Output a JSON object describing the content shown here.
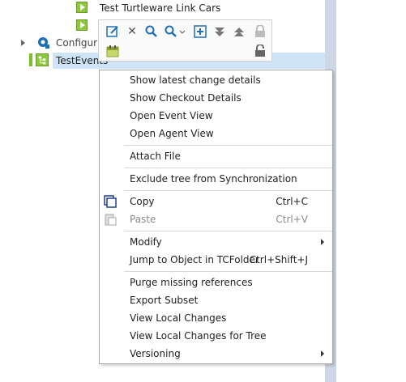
{
  "tree": {
    "items": [
      {
        "label": "Test Turtleware Link Cars"
      },
      {
        "label": ""
      },
      {
        "label": "Configur"
      },
      {
        "label": "TestEvents"
      }
    ]
  },
  "toolbar": {
    "buttons": [
      "edit-icon",
      "delete-icon",
      "search-icon",
      "search-dropdown-icon",
      "add-icon",
      "collapse-icon",
      "expand-icon",
      "lock-icon",
      "calendar-icon",
      "unlock-icon"
    ]
  },
  "menu": {
    "items": [
      {
        "label": "Show latest change details"
      },
      {
        "label": "Show Checkout Details"
      },
      {
        "label": "Open Event View"
      },
      {
        "label": "Open Agent View"
      },
      {
        "label": "Attach File"
      },
      {
        "label": "Exclude tree from Synchronization"
      },
      {
        "label": "Copy",
        "shortcut": "Ctrl+C"
      },
      {
        "label": "Paste",
        "shortcut": "Ctrl+V"
      },
      {
        "label": "Modify"
      },
      {
        "label": "Jump to Object in TCFolder",
        "shortcut": "Ctrl+Shift+J"
      },
      {
        "label": "Purge missing references"
      },
      {
        "label": "Export Subset"
      },
      {
        "label": "View Local Changes"
      },
      {
        "label": "View Local Changes for Tree"
      },
      {
        "label": "Versioning"
      }
    ]
  },
  "colors": {
    "selection": "#cfe4f7",
    "accent_green": "#8dc63f",
    "icon_blue": "#1f6fb5"
  }
}
